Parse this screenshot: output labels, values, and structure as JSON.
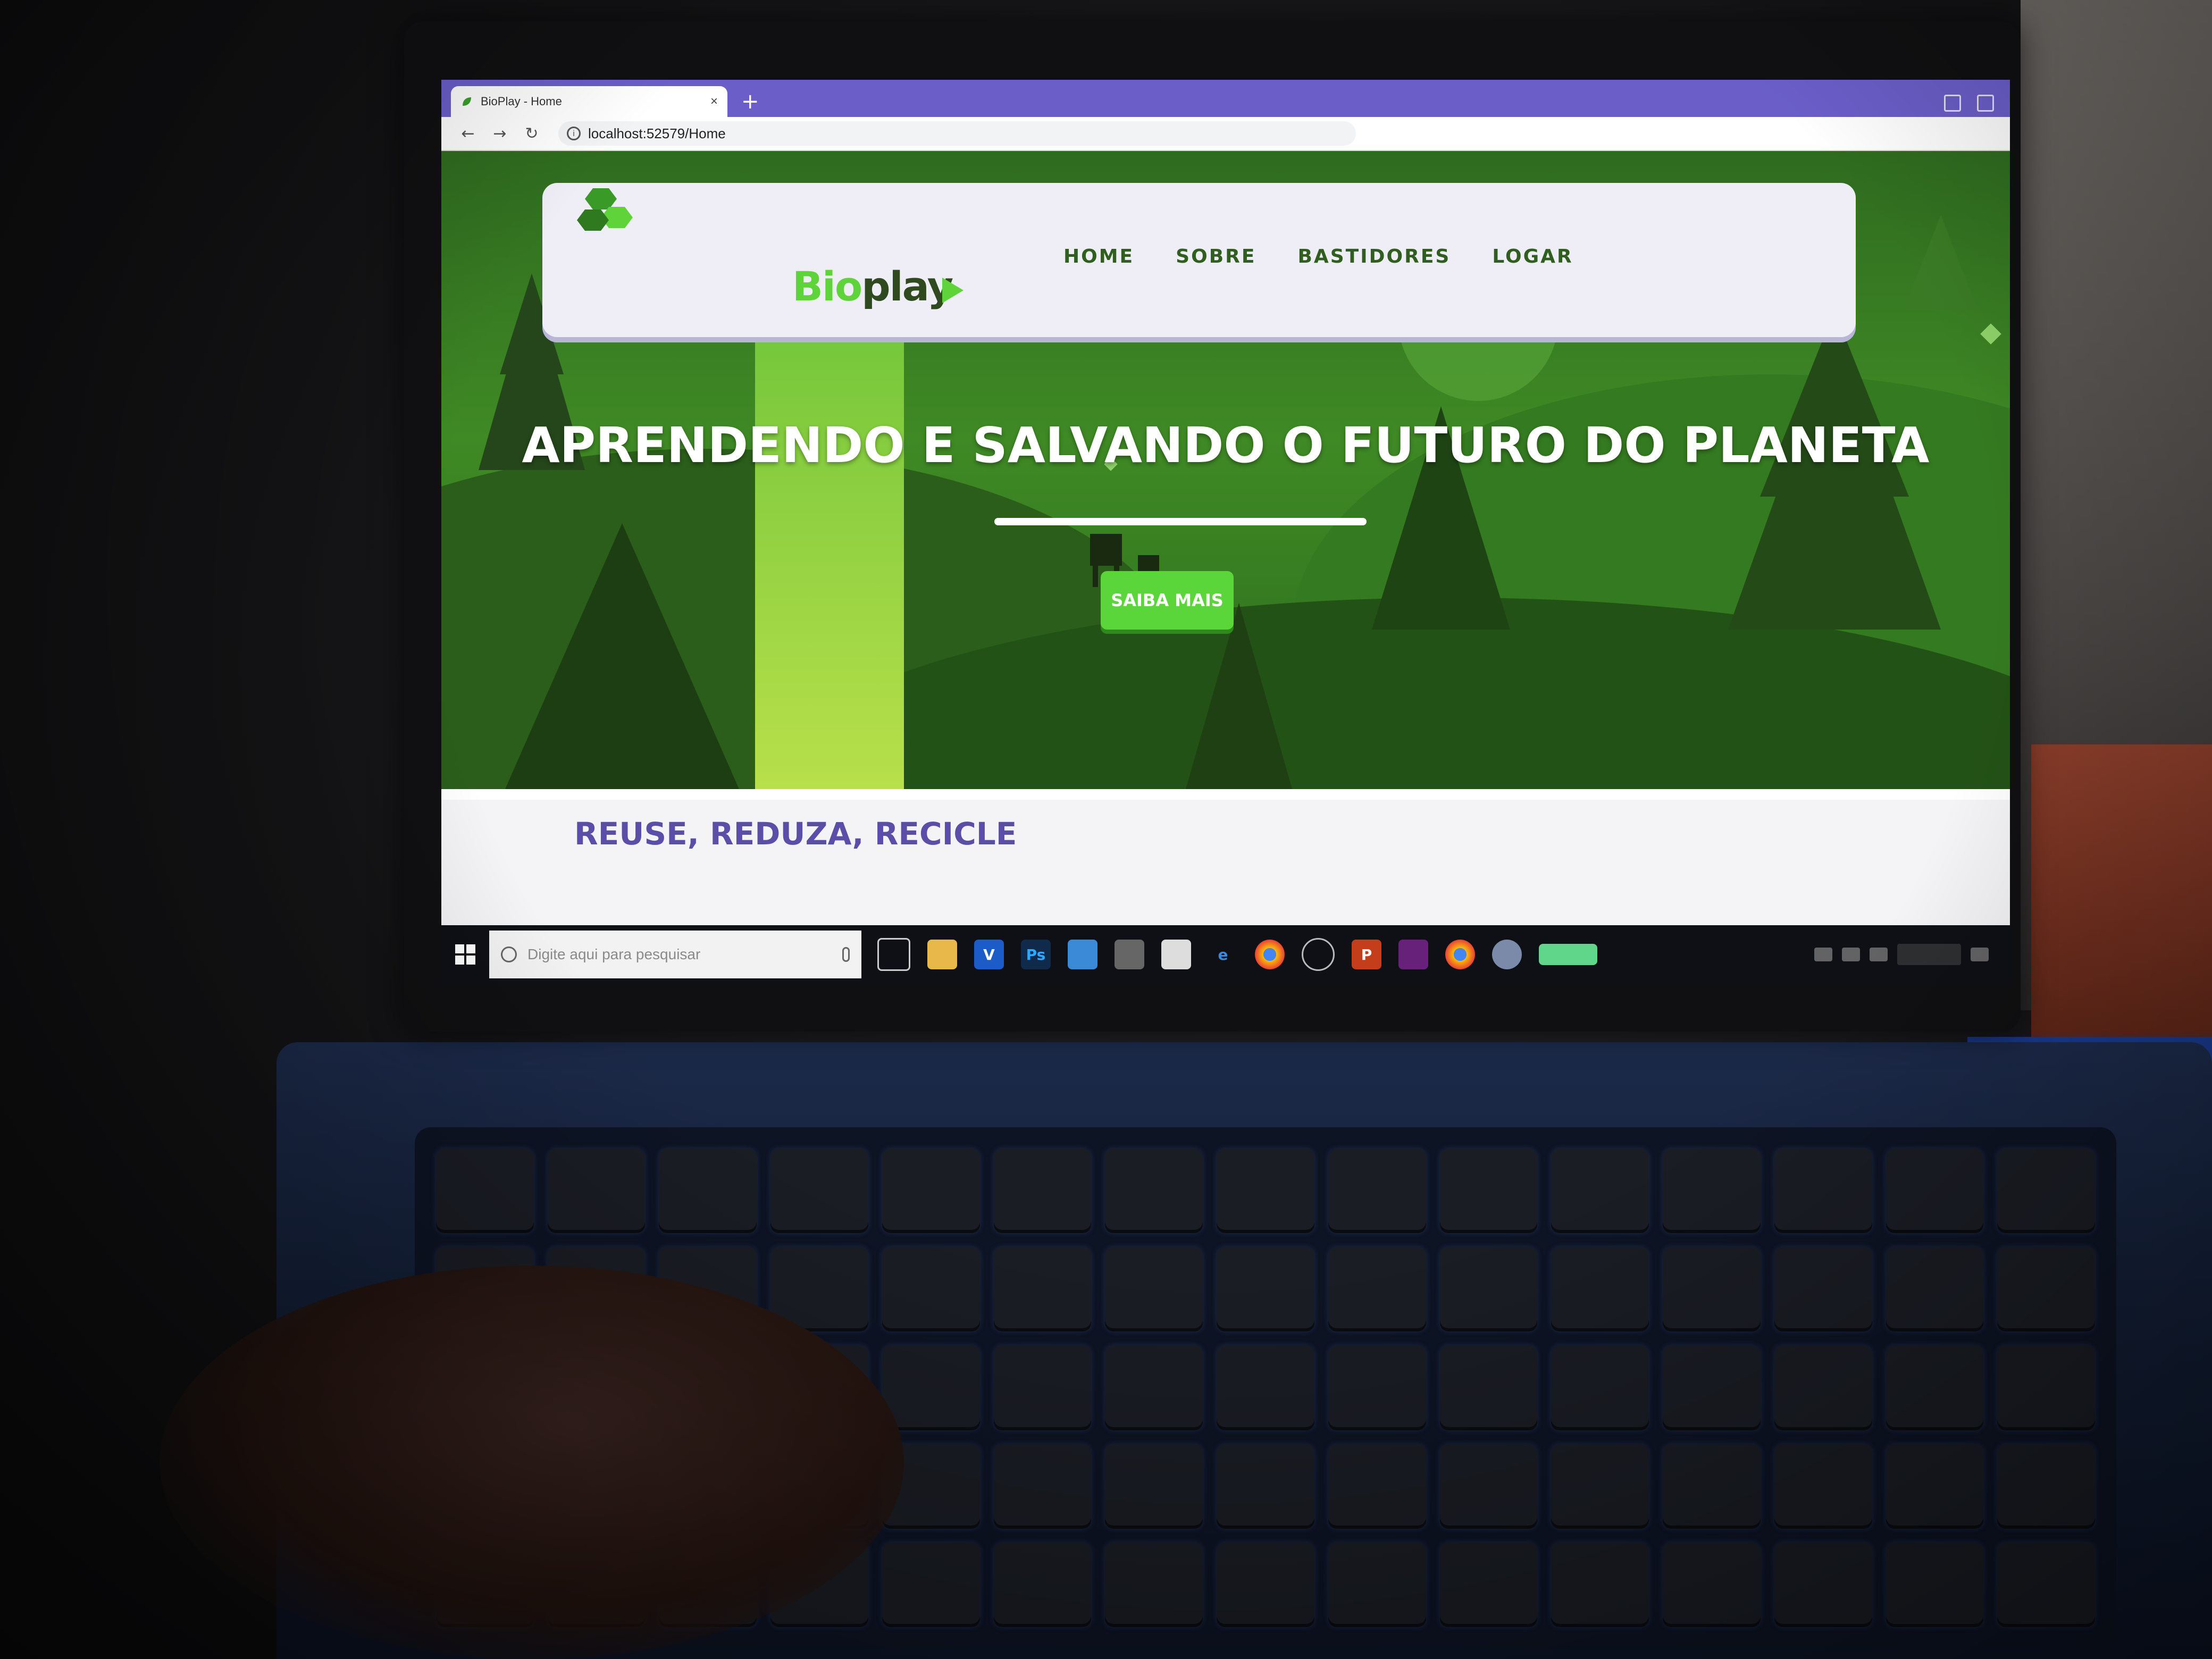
{
  "browser": {
    "tab_title": "BioPlay - Home",
    "tab_close": "×",
    "new_tab": "+",
    "url": "localhost:52579/Home",
    "back": "←",
    "forward": "→",
    "reload": "↻"
  },
  "site": {
    "logo_bio": "Bio",
    "logo_play": "play",
    "nav": [
      "HOME",
      "SOBRE",
      "BASTIDORES",
      "LOGAR"
    ],
    "headline": "APRENDENDO E SALVANDO O FUTURO DO PLANETA",
    "cta": "SAIBA MAIS",
    "section_title": "REUSE, REDUZA, RECICLE"
  },
  "taskbar": {
    "search_placeholder": "Digite aqui para pesquisar",
    "icons": [
      "task-view-icon",
      "file-explorer-icon",
      "v-app-icon",
      "photoshop-icon",
      "cube-app-icon",
      "store-icon",
      "mail-icon",
      "edge-icon",
      "chrome-icon",
      "app-icon",
      "powerpoint-icon",
      "visual-studio-icon",
      "chrome-icon-2",
      "app-icon-2",
      "battery-icon"
    ]
  },
  "colors": {
    "brand_green": "#5fd33a",
    "nav_green": "#2f5e1e",
    "hero_green": "#3f8a25",
    "section_purple": "#5a4ea8",
    "tabbar": "#6b5ec9"
  }
}
